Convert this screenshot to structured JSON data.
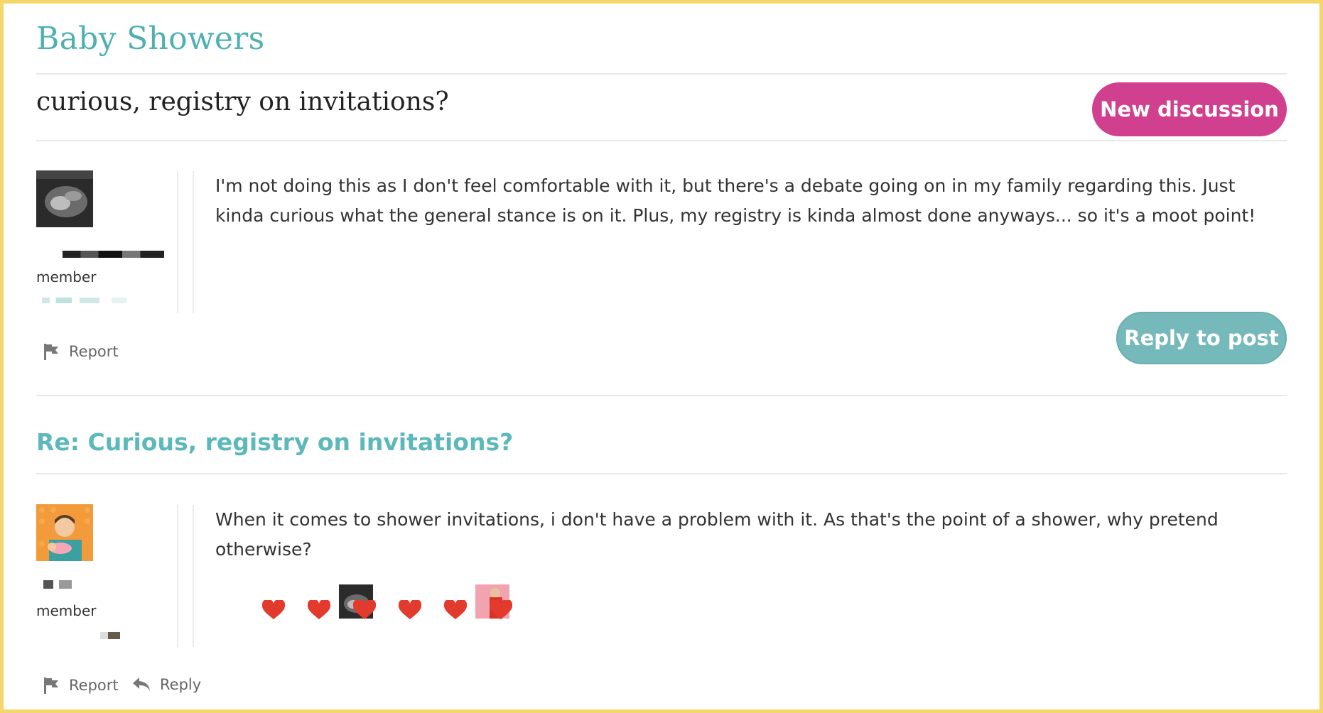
{
  "forum": {
    "title": "Baby Showers"
  },
  "thread": {
    "title": "curious, registry on invitations?"
  },
  "buttons": {
    "new_discussion": "New discussion",
    "reply_to_post": "Reply to post"
  },
  "original_post": {
    "author_role": "member",
    "body": "I'm not doing this as I don't feel comfortable with it, but there's a debate going on in my family regarding this. Just kinda curious what the general stance is on it. Plus, my registry is kinda almost done anyways... so it's a moot point!",
    "actions": {
      "report": "Report"
    }
  },
  "reply": {
    "title": "Re: Curious, registry on invitations?",
    "author_role": "member",
    "body": "When it comes to shower invitations, i don't have a problem with it. As that's the point of a shower, why pretend otherwise?",
    "actions": {
      "report": "Report",
      "reply": "Reply"
    },
    "reactions": [
      "heart",
      "heart",
      "heart",
      "heart",
      "heart",
      "heart"
    ]
  },
  "colors": {
    "accent_teal": "#4fb0b1",
    "new_discussion_bg": "#d1408f",
    "reply_button_bg": "#75b9bb",
    "heart": "#e23b2e",
    "frame": "#f5d66b"
  },
  "icons": [
    "flag-icon",
    "reply-arrow-icon",
    "heart-icon"
  ]
}
